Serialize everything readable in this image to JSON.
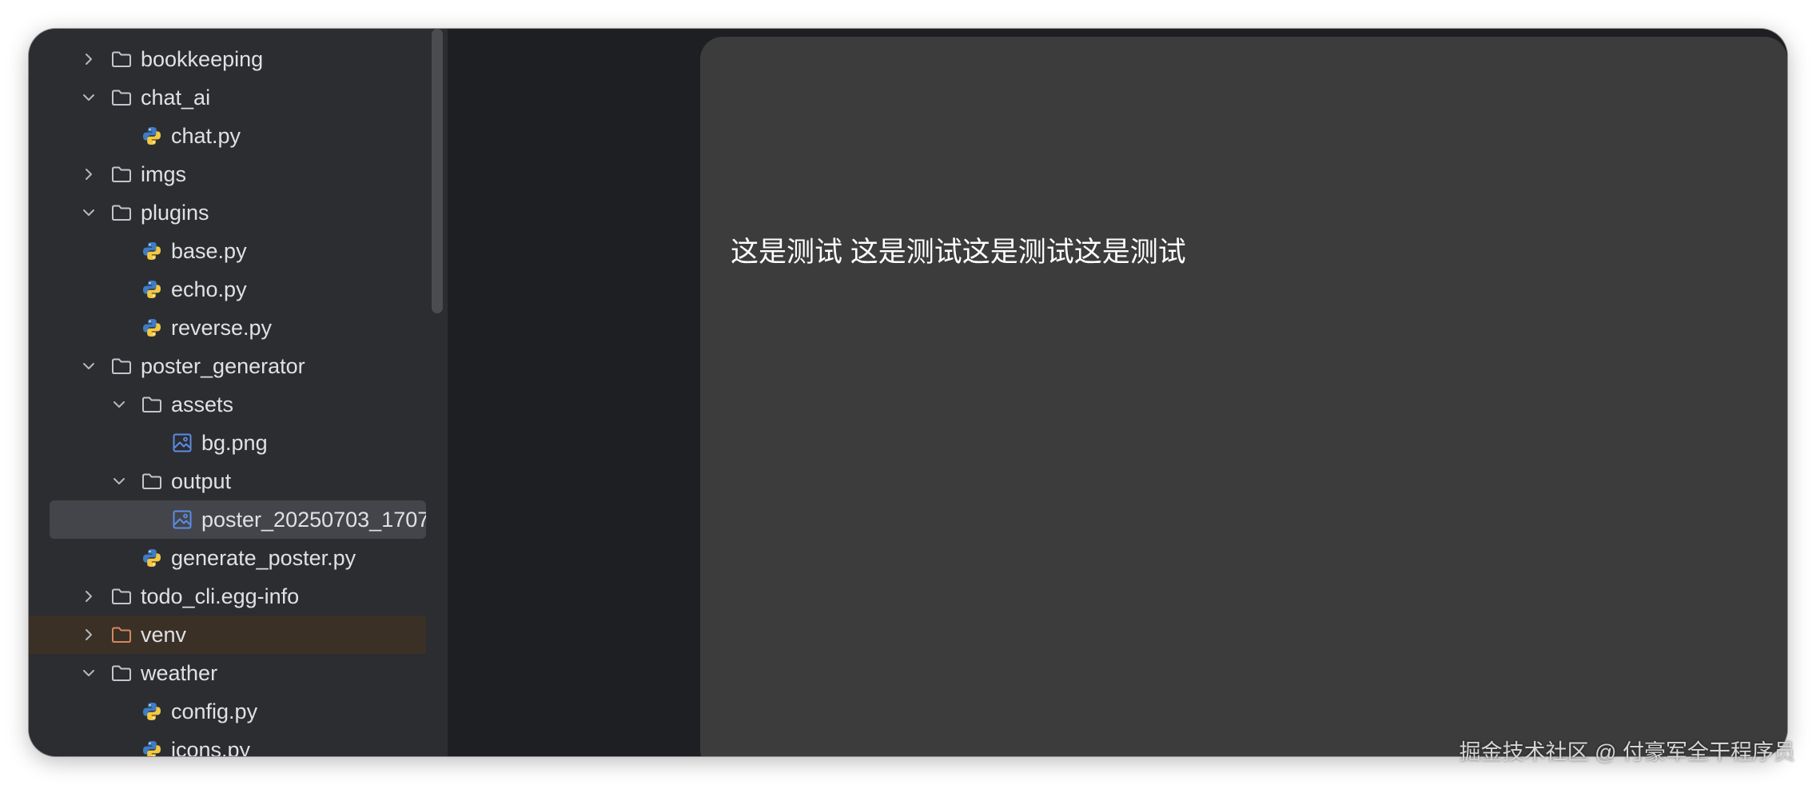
{
  "project_tree": {
    "items": [
      {
        "label": "bookkeeping",
        "kind": "folder",
        "state": "collapsed",
        "depth": 0
      },
      {
        "label": "chat_ai",
        "kind": "folder",
        "state": "expanded",
        "depth": 0
      },
      {
        "label": "chat.py",
        "kind": "python",
        "depth": 1
      },
      {
        "label": "imgs",
        "kind": "folder",
        "state": "collapsed",
        "depth": 0
      },
      {
        "label": "plugins",
        "kind": "folder",
        "state": "expanded",
        "depth": 0
      },
      {
        "label": "base.py",
        "kind": "python",
        "depth": 1
      },
      {
        "label": "echo.py",
        "kind": "python",
        "depth": 1
      },
      {
        "label": "reverse.py",
        "kind": "python",
        "depth": 1
      },
      {
        "label": "poster_generator",
        "kind": "folder",
        "state": "expanded",
        "depth": 0
      },
      {
        "label": "assets",
        "kind": "folder",
        "state": "expanded",
        "depth": 1
      },
      {
        "label": "bg.png",
        "kind": "image",
        "depth": 2
      },
      {
        "label": "output",
        "kind": "folder",
        "state": "expanded",
        "depth": 1
      },
      {
        "label": "poster_20250703_1707",
        "kind": "image",
        "depth": 2,
        "selected": true
      },
      {
        "label": "generate_poster.py",
        "kind": "python",
        "depth": 1
      },
      {
        "label": "todo_cli.egg-info",
        "kind": "folder",
        "state": "collapsed",
        "depth": 0
      },
      {
        "label": "venv",
        "kind": "folder-excluded",
        "state": "collapsed",
        "depth": 0
      },
      {
        "label": "weather",
        "kind": "folder",
        "state": "expanded",
        "depth": 0
      },
      {
        "label": "config.py",
        "kind": "python",
        "depth": 1
      },
      {
        "label": "icons.py",
        "kind": "python",
        "depth": 1
      }
    ]
  },
  "preview": {
    "text": "这是测试 这是测试这是测试这是测试"
  },
  "watermark": {
    "text": "掘金技术社区 @ 付豪军全干程序员"
  },
  "icons": {
    "chevron_collapsed": "chevron-right-icon",
    "chevron_expanded": "chevron-down-icon",
    "folder": "folder-icon",
    "python": "python-file-icon",
    "image": "image-file-icon"
  },
  "colors": {
    "sidebar_bg": "#2b2d30",
    "editor_bg": "#1e1f22",
    "preview_bg": "#3c3c3d",
    "selection_bg": "#43454a",
    "excluded_bg": "#3a3026",
    "excluded_folder": "#d7865c",
    "python_blue": "#3f7cc4",
    "python_yellow": "#f2c744",
    "image_blue": "#5c8ce6"
  }
}
